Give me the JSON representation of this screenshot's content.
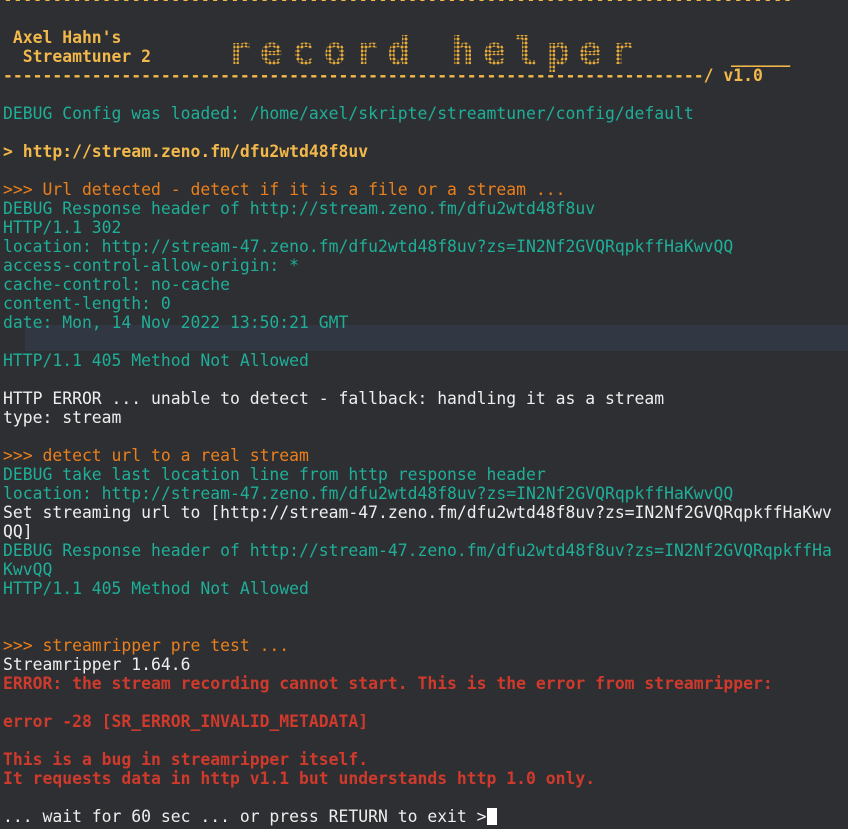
{
  "header": {
    "dashes_top": "--------------------------------------------------------------------------------",
    "author_line": " Axel Hahn's",
    "app_line": "  Streamtuner 2",
    "logo": "record helper",
    "underline": "______",
    "dashes_bottom": "-----------------------------------------------------------------------/ v1.0"
  },
  "lines": [
    {
      "style": "teal",
      "text": "DEBUG Config was loaded: /home/axel/skripte/streamtuner/config/default"
    },
    {
      "style": "teal",
      "text": ""
    },
    {
      "style": "yel",
      "text": "> http://stream.zeno.fm/dfu2wtd48f8uv"
    },
    {
      "style": "teal",
      "text": ""
    },
    {
      "style": "org",
      "text": ">>> Url detected - detect if it is a file or a stream ..."
    },
    {
      "style": "teal",
      "text": "DEBUG Response header of http://stream.zeno.fm/dfu2wtd48f8uv"
    },
    {
      "style": "teal",
      "text": "HTTP/1.1 302"
    },
    {
      "style": "teal",
      "text": "location: http://stream-47.zeno.fm/dfu2wtd48f8uv?zs=IN2Nf2GVQRqpkffHaKwvQQ"
    },
    {
      "style": "teal",
      "text": "access-control-allow-origin: *"
    },
    {
      "style": "teal",
      "text": "cache-control: no-cache"
    },
    {
      "style": "teal",
      "text": "content-length: 0"
    },
    {
      "style": "teal",
      "text": "date: Mon, 14 Nov 2022 13:50:21 GMT"
    },
    {
      "style": "teal",
      "text": ""
    },
    {
      "style": "teal",
      "text": "HTTP/1.1 405 Method Not Allowed"
    },
    {
      "style": "teal",
      "text": ""
    },
    {
      "style": "wht",
      "text": "HTTP ERROR ... unable to detect - fallback: handling it as a stream"
    },
    {
      "style": "wht",
      "text": "type: stream"
    },
    {
      "style": "wht",
      "text": ""
    },
    {
      "style": "org",
      "text": ">>> detect url to a real stream"
    },
    {
      "style": "teal",
      "text": "DEBUG take last location line from http response header"
    },
    {
      "style": "teal",
      "text": "location: http://stream-47.zeno.fm/dfu2wtd48f8uv?zs=IN2Nf2GVQRqpkffHaKwvQQ"
    },
    {
      "style": "wht",
      "text": "Set streaming url to [http://stream-47.zeno.fm/dfu2wtd48f8uv?zs=IN2Nf2GVQRqpkffHaKwv"
    },
    {
      "style": "wht",
      "text": "QQ]"
    },
    {
      "style": "teal",
      "text": "DEBUG Response header of http://stream-47.zeno.fm/dfu2wtd48f8uv?zs=IN2Nf2GVQRqpkffHa"
    },
    {
      "style": "teal",
      "text": "KwvQQ"
    },
    {
      "style": "teal",
      "text": "HTTP/1.1 405 Method Not Allowed"
    },
    {
      "style": "teal",
      "text": ""
    },
    {
      "style": "teal",
      "text": ""
    },
    {
      "style": "org",
      "text": ">>> streamripper pre test ..."
    },
    {
      "style": "wht",
      "text": "Streamripper 1.64.6"
    },
    {
      "style": "red",
      "text": "ERROR: the stream recording cannot start. This is the error from streamripper:"
    },
    {
      "style": "red",
      "text": ""
    },
    {
      "style": "red",
      "text": "error -28 [SR_ERROR_INVALID_METADATA]"
    },
    {
      "style": "red",
      "text": ""
    },
    {
      "style": "red",
      "text": "This is a bug in streamripper itself."
    },
    {
      "style": "red",
      "text": "It requests data in http v1.1 but understands http 1.0 only."
    },
    {
      "style": "wht",
      "text": ""
    }
  ],
  "prompt": {
    "text": "... wait for 60 sec ... or press RETURN to exit >"
  },
  "colors": {
    "background": "#2d2f32",
    "debug": "#1fae98",
    "section": "#ec7f1c",
    "error": "#cf3a2c",
    "header": "#f2b84b",
    "text": "#eeeeee"
  }
}
